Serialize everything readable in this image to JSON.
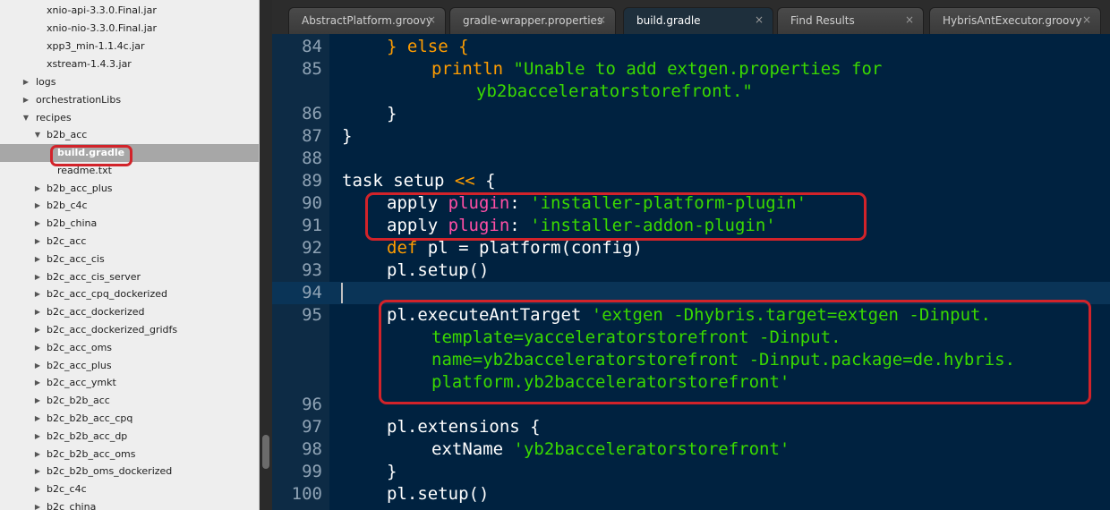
{
  "sidebar": {
    "items": [
      {
        "label": "xnio-api-3.3.0.Final.jar"
      },
      {
        "label": "xnio-nio-3.3.0.Final.jar"
      },
      {
        "label": "xpp3_min-1.1.4c.jar"
      },
      {
        "label": "xstream-1.4.3.jar"
      },
      {
        "label": "logs"
      },
      {
        "label": "orchestrationLibs"
      },
      {
        "label": "recipes"
      },
      {
        "label": "b2b_acc"
      },
      {
        "label": "build.gradle"
      },
      {
        "label": "readme.txt"
      },
      {
        "label": "b2b_acc_plus"
      },
      {
        "label": "b2b_c4c"
      },
      {
        "label": "b2b_china"
      },
      {
        "label": "b2c_acc"
      },
      {
        "label": "b2c_acc_cis"
      },
      {
        "label": "b2c_acc_cis_server"
      },
      {
        "label": "b2c_acc_cpq_dockerized"
      },
      {
        "label": "b2c_acc_dockerized"
      },
      {
        "label": "b2c_acc_dockerized_gridfs"
      },
      {
        "label": "b2c_acc_oms"
      },
      {
        "label": "b2c_acc_plus"
      },
      {
        "label": "b2c_acc_ymkt"
      },
      {
        "label": "b2c_b2b_acc"
      },
      {
        "label": "b2c_b2b_acc_cpq"
      },
      {
        "label": "b2c_b2b_acc_dp"
      },
      {
        "label": "b2c_b2b_acc_oms"
      },
      {
        "label": "b2c_b2b_oms_dockerized"
      },
      {
        "label": "b2c_c4c"
      },
      {
        "label": "b2c_china"
      }
    ]
  },
  "tabs": [
    {
      "label": "AbstractPlatform.groovy",
      "close": "×"
    },
    {
      "label": "gradle-wrapper.properties",
      "close": "×"
    },
    {
      "label": "build.gradle",
      "close": "×"
    },
    {
      "label": "Find Results",
      "close": "×"
    },
    {
      "label": "HybrisAntExecutor.groovy",
      "close": "×"
    }
  ],
  "editor": {
    "line_numbers": [
      "84",
      "85",
      "",
      "86",
      "87",
      "88",
      "89",
      "90",
      "91",
      "92",
      "93",
      "94",
      "95",
      "",
      "",
      "",
      "96",
      "97",
      "98",
      "99",
      "100"
    ],
    "code": {
      "l84_kw": "} else {",
      "l85_fn": "println",
      "l85_str": "\"Unable to add extgen.properties for",
      "l85b_str": "yb2bacceleratorstorefront.\"",
      "l86": "}",
      "l87": "}",
      "l89_a": "task setup ",
      "l89_b": "<<",
      "l89_c": " {",
      "l90_a": "apply ",
      "l90_b": "plugin",
      "l90_c": ": ",
      "l90_d": "'installer-platform-plugin'",
      "l91_a": "apply ",
      "l91_b": "plugin",
      "l91_c": ": ",
      "l91_d": "'installer-addon-plugin'",
      "l92_a": "def",
      "l92_b": " pl = platform(config)",
      "l93": "pl.setup()",
      "l95_a": "pl.executeAntTarget ",
      "l95_b": "'extgen -Dhybris.target=extgen -Dinput.",
      "l95c": "template=yacceleratorstorefront -Dinput.",
      "l95d": "name=yb2bacceleratorstorefront -Dinput.package=de.hybris.",
      "l95e": "platform.yb2bacceleratorstorefront'",
      "l97": "pl.extensions {",
      "l98_a": "extName ",
      "l98_b": "'yb2bacceleratorstorefront'",
      "l99": "}",
      "l100": "pl.setup()"
    }
  },
  "colors": {
    "editor_bg": "#002240",
    "keyword": "#ff9d00",
    "string": "#3ad900",
    "plugin": "#ff4fa5",
    "highlight_box": "#d2232a"
  }
}
